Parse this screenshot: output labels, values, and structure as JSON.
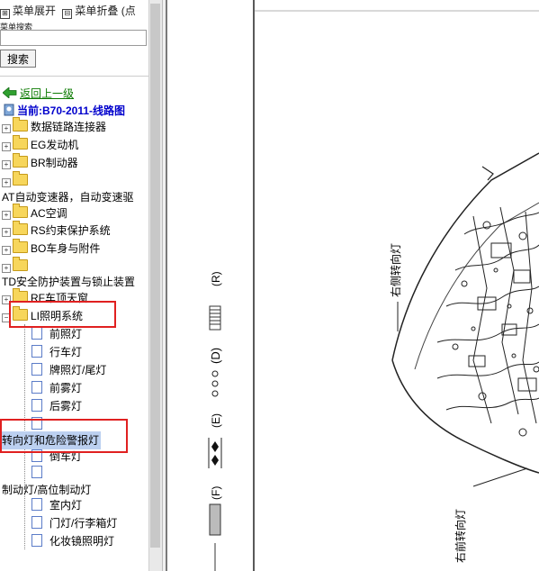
{
  "toolbar": {
    "expand_label": "菜单展开",
    "collapse_label": "菜单折叠 (点"
  },
  "search": {
    "label": "菜单搜索",
    "button": "搜索",
    "placeholder": ""
  },
  "nav": {
    "back_label": "返回上一级",
    "current_label": "当前:B70-2011-线路图"
  },
  "tree": {
    "items": [
      "数据链路连接器",
      "EG发动机",
      "BR制动器",
      "",
      "AT自动变速器，自动变速驱",
      "AC空调",
      "RS约束保护系统",
      "BO车身与附件",
      "",
      "TD安全防护装置与锁止装置",
      "RF车顶天窗",
      "LI照明系统"
    ],
    "li_children": [
      "前照灯",
      "行车灯",
      "牌照灯/尾灯",
      "前雾灯",
      "后雾灯",
      "",
      "转向灯和危险警报灯",
      "倒车灯",
      "",
      "制动灯/高位制动灯",
      "室内灯",
      "门灯/行李箱灯",
      "化妆镜照明灯"
    ]
  },
  "document": {
    "legend": [
      "(R)",
      "(D)",
      "(E)",
      "(F)"
    ],
    "labels": [
      "右侧转向灯",
      "右前转向灯"
    ]
  },
  "colors": {
    "accent_green": "#0a7a00",
    "current_blue": "#0000cc",
    "highlight": "#e02020"
  }
}
